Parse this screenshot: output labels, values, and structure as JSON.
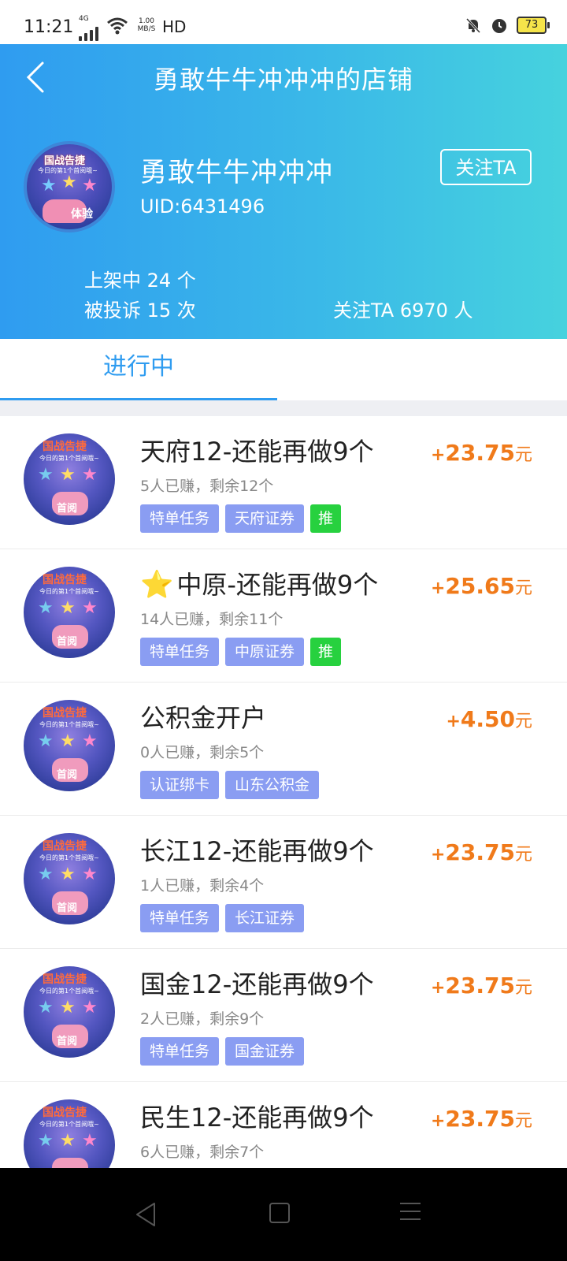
{
  "status_bar": {
    "time": "11:21",
    "network": "4G",
    "speed": "1.00 MB/S",
    "hd": "HD",
    "battery": "73"
  },
  "header": {
    "title": "勇敢牛牛冲冲冲的店铺"
  },
  "profile": {
    "avatar_text_1": "国战告捷",
    "avatar_text_2": "今日的第1个首阅哦~",
    "avatar_text_3": "体验",
    "name": "勇敢牛牛冲冲冲",
    "uid": "UID:6431496",
    "follow_label": "关注TA",
    "listed": "上架中 24 个",
    "complaints": "被投诉 15 次",
    "followers": "关注TA 6970 人"
  },
  "tabs": [
    {
      "label": "进行中",
      "active": true
    }
  ],
  "thumb": {
    "line1": "国战告捷",
    "line2": "今日的第1个首阅哦~",
    "line3": "首阅"
  },
  "items": [
    {
      "title": "天府12-还能再做9个",
      "starred": false,
      "meta": "5人已赚，剩余12个",
      "tags": [
        "特单任务",
        "天府证券"
      ],
      "push": "推",
      "plus": "+",
      "price": "23.75",
      "unit": "元"
    },
    {
      "title": "中原-还能再做9个",
      "starred": true,
      "meta": "14人已赚，剩余11个",
      "tags": [
        "特单任务",
        "中原证券"
      ],
      "push": "推",
      "plus": "+",
      "price": "25.65",
      "unit": "元"
    },
    {
      "title": "公积金开户",
      "starred": false,
      "meta": "0人已赚，剩余5个",
      "tags": [
        "认证绑卡",
        "山东公积金"
      ],
      "push": "",
      "plus": "+",
      "price": "4.50",
      "unit": "元"
    },
    {
      "title": "长江12-还能再做9个",
      "starred": false,
      "meta": "1人已赚，剩余4个",
      "tags": [
        "特单任务",
        "长江证券"
      ],
      "push": "",
      "plus": "+",
      "price": "23.75",
      "unit": "元"
    },
    {
      "title": "国金12-还能再做9个",
      "starred": false,
      "meta": "2人已赚，剩余9个",
      "tags": [
        "特单任务",
        "国金证券"
      ],
      "push": "",
      "plus": "+",
      "price": "23.75",
      "unit": "元"
    },
    {
      "title": "民生12-还能再做9个",
      "starred": false,
      "meta": "6人已赚，剩余7个",
      "tags": [],
      "push": "",
      "plus": "+",
      "price": "23.75",
      "unit": "元"
    }
  ],
  "colors": {
    "accent": "#2f9cf0",
    "price": "#f07a1a",
    "tag": "#8a9df2",
    "push_tag": "#27d13f"
  }
}
